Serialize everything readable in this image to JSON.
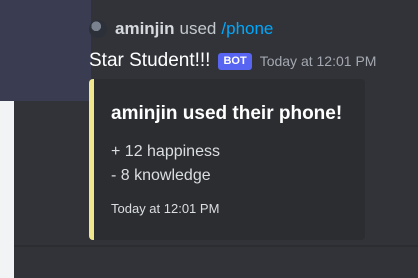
{
  "reply": {
    "user": "aminjin",
    "verb": "used",
    "command": "/phone",
    "avatar_icon": "user-avatar-icon"
  },
  "message": {
    "author": "Star Student!!!",
    "bot_tag": "BOT",
    "timestamp": "Today at 12:01 PM"
  },
  "embed": {
    "title": "aminjin used their phone!",
    "lines": [
      "+ 12 happiness",
      "- 8 knowledge"
    ],
    "footer": "Today at 12:01 PM",
    "accent_color": "#f0e68c"
  },
  "colors": {
    "background": "#313338",
    "embed_background": "#2b2d31",
    "command_link": "#00a8fc",
    "bot_tag": "#5865f2"
  }
}
